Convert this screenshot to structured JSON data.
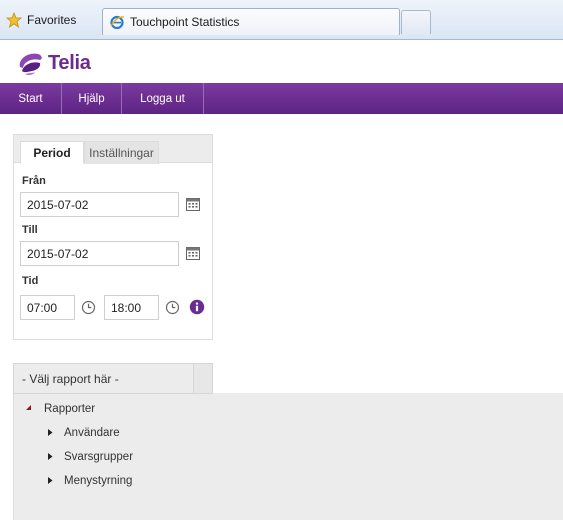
{
  "browser": {
    "favorites_label": "Favorites",
    "tab_title": "Touchpoint Statistics"
  },
  "header": {
    "logo_text": "Telia",
    "brand_color": "#6b2c91"
  },
  "nav": {
    "items": [
      "Start",
      "Hjälp",
      "Logga ut"
    ]
  },
  "period_panel": {
    "tabs": [
      "Period",
      "Inställningar"
    ],
    "from_label": "Från",
    "from_value": "2015-07-02",
    "to_label": "Till",
    "to_value": "2015-07-02",
    "time_label": "Tid",
    "time_from": "07:00",
    "time_to": "18:00"
  },
  "report": {
    "select_placeholder": "- Välj rapport här -",
    "root": "Rapporter",
    "children": [
      "Användare",
      "Svarsgrupper",
      "Menystyrning"
    ]
  }
}
